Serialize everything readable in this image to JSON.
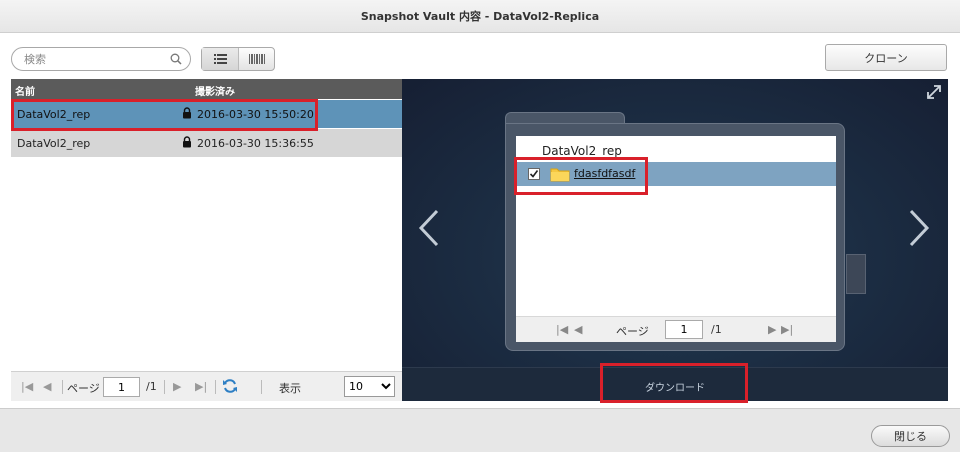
{
  "window": {
    "title": "Snapshot Vault 内容 - DataVol2-Replica"
  },
  "toolbar": {
    "search_placeholder": "検索",
    "clone_label": "クローン"
  },
  "table": {
    "columns": [
      "名前",
      "撮影済み"
    ],
    "rows": [
      {
        "name": "DataVol2_rep",
        "taken": "2016-03-30 15:50:20",
        "selected": true
      },
      {
        "name": "DataVol2_rep",
        "taken": "2016-03-30 15:36:55",
        "selected": false
      }
    ]
  },
  "left_pager": {
    "page_label": "ページ",
    "page_value": "1",
    "total": "/1",
    "display_label": "表示",
    "per_page": "10"
  },
  "browser": {
    "header": "DataVol2_rep",
    "items": [
      {
        "name": "fdasfdfasdf",
        "checked": true
      }
    ],
    "pager": {
      "page_label": "ページ",
      "page_value": "1",
      "total": "/1"
    },
    "download_label": "ダウンロード"
  },
  "footer": {
    "close_label": "閉じる"
  },
  "colors": {
    "selection": "#5e93b8",
    "highlight": "#d9202a",
    "dark_panel": "#1c2e44"
  }
}
